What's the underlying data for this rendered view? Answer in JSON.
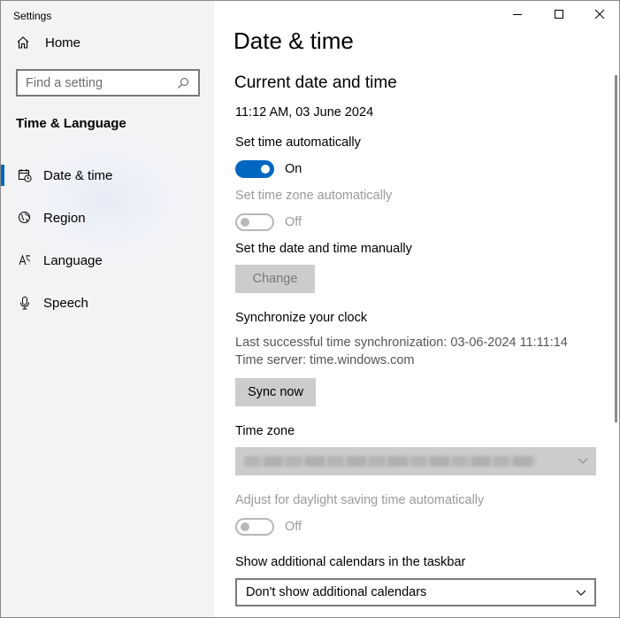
{
  "window": {
    "app_title": "Settings",
    "controls": [
      "minimize-icon",
      "maximize-icon",
      "close-icon"
    ]
  },
  "sidebar": {
    "home_label": "Home",
    "home_icon": "home-icon",
    "search_placeholder": "Find a setting",
    "search_icon": "search-icon",
    "section_title": "Time & Language",
    "items": [
      {
        "label": "Date & time",
        "icon": "date-time-icon",
        "selected": true
      },
      {
        "label": "Region",
        "icon": "globe-icon",
        "selected": false
      },
      {
        "label": "Language",
        "icon": "language-icon",
        "selected": false
      },
      {
        "label": "Speech",
        "icon": "microphone-icon",
        "selected": false
      }
    ],
    "accent_color": "#0067c0"
  },
  "main": {
    "title": "Date & time",
    "current_heading": "Current date and time",
    "current_value": "11:12 AM, 03 June 2024",
    "set_time_auto": {
      "label": "Set time automatically",
      "state": "On"
    },
    "set_zone_auto": {
      "label": "Set time zone automatically",
      "state": "Off"
    },
    "manual": {
      "label": "Set the date and time manually",
      "button": "Change"
    },
    "sync": {
      "heading": "Synchronize your clock",
      "last_sync": "Last successful time synchronization: 03-06-2024 11:11:14",
      "server": "Time server: time.windows.com",
      "button": "Sync now"
    },
    "timezone": {
      "label": "Time zone"
    },
    "dst": {
      "label": "Adjust for daylight saving time automatically",
      "state": "Off"
    },
    "calendars": {
      "label": "Show additional calendars in the taskbar",
      "value": "Don't show additional calendars"
    }
  }
}
